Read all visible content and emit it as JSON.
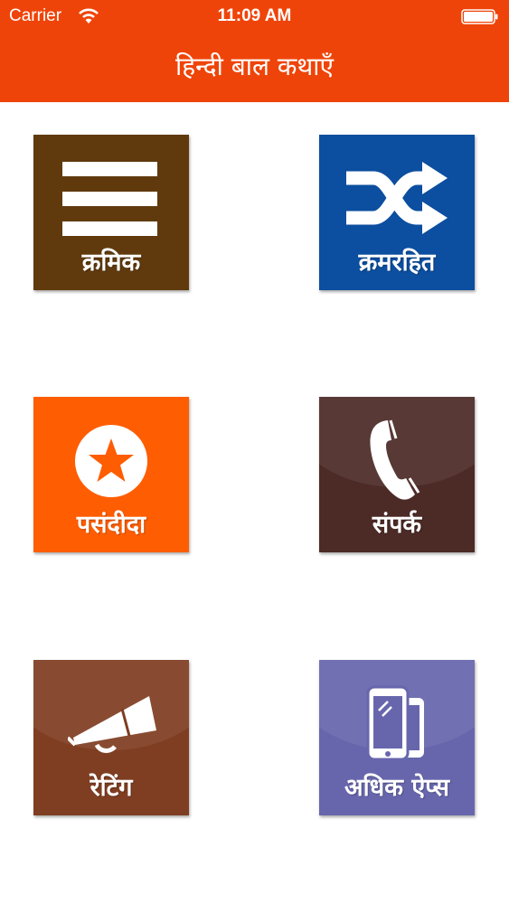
{
  "status_bar": {
    "carrier": "Carrier",
    "time": "11:09 AM"
  },
  "header": {
    "title": "हिन्दी बाल कथाएँ"
  },
  "tiles": [
    {
      "label": "क्रमिक",
      "icon": "list-icon",
      "color": "#603a0d"
    },
    {
      "label": "क्रमरहित",
      "icon": "shuffle-icon",
      "color": "#0c4e9f"
    },
    {
      "label": "पसंदीदा",
      "icon": "star-icon",
      "color": "#fe5d02"
    },
    {
      "label": "संपर्क",
      "icon": "phone-icon",
      "color": "#4c2a26"
    },
    {
      "label": "रेटिंग",
      "icon": "megaphone-icon",
      "color": "#7f3e22"
    },
    {
      "label": "अधिक ऐप्स",
      "icon": "devices-icon",
      "color": "#6766ad"
    }
  ],
  "colors": {
    "header": "#ef4409",
    "background": "#ffffff"
  }
}
